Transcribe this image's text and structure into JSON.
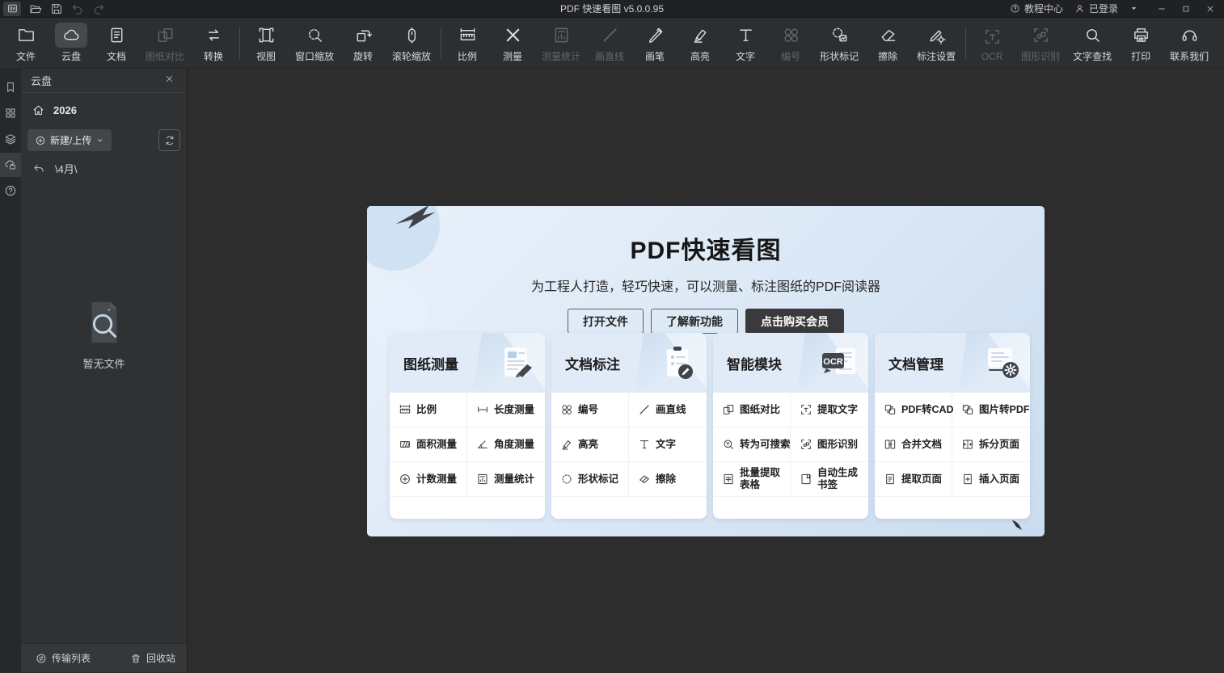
{
  "app": {
    "title": "PDF 快速看图 v5.0.0.95"
  },
  "titlebar": {
    "left_icons": [
      "app-logo",
      "folder-open",
      "save",
      "undo",
      "redo"
    ],
    "tutorial_label": "教程中心",
    "login_label": "已登录"
  },
  "toolbar": {
    "groups": [
      {
        "items": [
          {
            "id": "file",
            "label": "文件",
            "icon": "folder",
            "state": "normal"
          },
          {
            "id": "cloud-drive",
            "label": "云盘",
            "icon": "cloud",
            "state": "selected"
          },
          {
            "id": "document",
            "label": "文档",
            "icon": "document",
            "state": "normal"
          },
          {
            "id": "drawing-compare",
            "label": "图纸对比",
            "icon": "doc-compare",
            "state": "disabled"
          },
          {
            "id": "convert",
            "label": "转换",
            "icon": "convert",
            "state": "normal"
          }
        ]
      },
      {
        "items": [
          {
            "id": "view",
            "label": "视图",
            "icon": "view",
            "state": "normal"
          },
          {
            "id": "window-zoom",
            "label": "窗口缩放",
            "icon": "window-zoom",
            "state": "normal"
          },
          {
            "id": "rotate",
            "label": "旋转",
            "icon": "rotate",
            "state": "normal"
          },
          {
            "id": "wheel-zoom",
            "label": "滚轮缩放",
            "icon": "wheel-zoom",
            "state": "normal"
          }
        ]
      },
      {
        "items": [
          {
            "id": "scale",
            "label": "比例",
            "icon": "scale-ruler",
            "state": "normal"
          },
          {
            "id": "measure",
            "label": "测量",
            "icon": "measure-x",
            "state": "normal"
          },
          {
            "id": "measure-stats",
            "label": "测量统计",
            "icon": "measure-stats",
            "state": "disabled"
          },
          {
            "id": "draw-line",
            "label": "画直线",
            "icon": "line",
            "state": "disabled"
          },
          {
            "id": "pen",
            "label": "画笔",
            "icon": "pen",
            "state": "normal"
          },
          {
            "id": "highlight",
            "label": "高亮",
            "icon": "highlighter",
            "state": "normal"
          },
          {
            "id": "text",
            "label": "文字",
            "icon": "text-t",
            "state": "normal"
          },
          {
            "id": "numbering",
            "label": "编号",
            "icon": "numbering",
            "state": "disabled"
          },
          {
            "id": "shape-mark",
            "label": "形状标记",
            "icon": "shape-mark",
            "state": "normal"
          },
          {
            "id": "erase",
            "label": "擦除",
            "icon": "eraser",
            "state": "normal"
          },
          {
            "id": "annotation-settings",
            "label": "标注设置",
            "icon": "annot-settings",
            "state": "normal"
          }
        ]
      },
      {
        "items": [
          {
            "id": "ocr",
            "label": "OCR",
            "icon": "ocr",
            "state": "disabled"
          },
          {
            "id": "shape-recognition",
            "label": "图形识别",
            "icon": "shape-recog",
            "state": "disabled"
          },
          {
            "id": "text-search",
            "label": "文字查找",
            "icon": "search",
            "state": "normal"
          },
          {
            "id": "print",
            "label": "打印",
            "icon": "print",
            "state": "normal"
          },
          {
            "id": "contact-us",
            "label": "联系我们",
            "icon": "headset",
            "state": "normal"
          }
        ]
      }
    ]
  },
  "sidebar": {
    "rail": [
      {
        "id": "bookmarks",
        "icon": "bookmark",
        "selected": false
      },
      {
        "id": "thumbnails",
        "icon": "thumbnails",
        "selected": false
      },
      {
        "id": "layers",
        "icon": "layers",
        "selected": false
      },
      {
        "id": "cloud-drive",
        "icon": "cloud-files",
        "selected": true
      },
      {
        "id": "help",
        "icon": "help",
        "selected": false
      }
    ],
    "panel_title": "云盘",
    "home_label": "2026",
    "new_upload_label": "新建/上传",
    "path_label": "\\4月\\",
    "empty_text": "暂无文件",
    "footer": {
      "transfer_label": "传输列表",
      "recycle_label": "回收站"
    }
  },
  "welcome": {
    "title": "PDF快速看图",
    "subtitle": "为工程人打造，轻巧快速，可以测量、标注图纸的PDF阅读器",
    "buttons": [
      {
        "id": "open-file-button",
        "label": "打开文件",
        "style": "outline"
      },
      {
        "id": "new-features-button",
        "label": "了解新功能",
        "style": "outline"
      },
      {
        "id": "buy-membership-button",
        "label": "点击购买会员",
        "style": "dark"
      }
    ],
    "cards": [
      {
        "id": "drawing-measure",
        "title": "图纸测量",
        "art": "art-measure",
        "items": [
          {
            "label": "比例",
            "icon": "scale-ruler"
          },
          {
            "label": "长度测量",
            "icon": "it-length"
          },
          {
            "label": "面积测量",
            "icon": "it-area"
          },
          {
            "label": "角度测量",
            "icon": "it-angle"
          },
          {
            "label": "计数测量",
            "icon": "it-count"
          },
          {
            "label": "测量统计",
            "icon": "measure-stats"
          }
        ]
      },
      {
        "id": "doc-annotate",
        "title": "文档标注",
        "art": "art-annotate",
        "items": [
          {
            "label": "编号",
            "icon": "numbering"
          },
          {
            "label": "画直线",
            "icon": "line"
          },
          {
            "label": "高亮",
            "icon": "highlighter"
          },
          {
            "label": "文字",
            "icon": "text-t"
          },
          {
            "label": "形状标记",
            "icon": "it-shape"
          },
          {
            "label": "擦除",
            "icon": "it-erase"
          }
        ]
      },
      {
        "id": "smart-modules",
        "title": "智能模块",
        "art": "art-smart",
        "items": [
          {
            "label": "图纸对比",
            "icon": "doc-compare"
          },
          {
            "label": "提取文字",
            "icon": "ocr"
          },
          {
            "label": "转为可搜索",
            "icon": "it-searchable"
          },
          {
            "label": "图形识别",
            "icon": "shape-recog"
          },
          {
            "label": "批量提取\n表格",
            "icon": "it-table"
          },
          {
            "label": "自动生成\n书签",
            "icon": "it-bookmark-gen"
          }
        ]
      },
      {
        "id": "doc-manage",
        "title": "文档管理",
        "art": "art-manage",
        "items": [
          {
            "label": "PDF转CAD",
            "icon": "it-pdf2cad"
          },
          {
            "label": "图片转PDF",
            "icon": "it-img2pdf"
          },
          {
            "label": "合并文档",
            "icon": "it-merge"
          },
          {
            "label": "拆分页面",
            "icon": "it-split"
          },
          {
            "label": "提取页面",
            "icon": "it-extract-page"
          },
          {
            "label": "插入页面",
            "icon": "it-insert-page"
          }
        ]
      }
    ]
  },
  "colors": {
    "titlebar_bg": "#202124",
    "toolbar_bg": "#2c2e30",
    "sidebar_bg": "#2f3133",
    "main_bg": "#2d2d2e",
    "panel_blue": "#d9e6f4",
    "card_header_blue": "#e0ebf7",
    "dark_button": "#3a3a3c"
  }
}
